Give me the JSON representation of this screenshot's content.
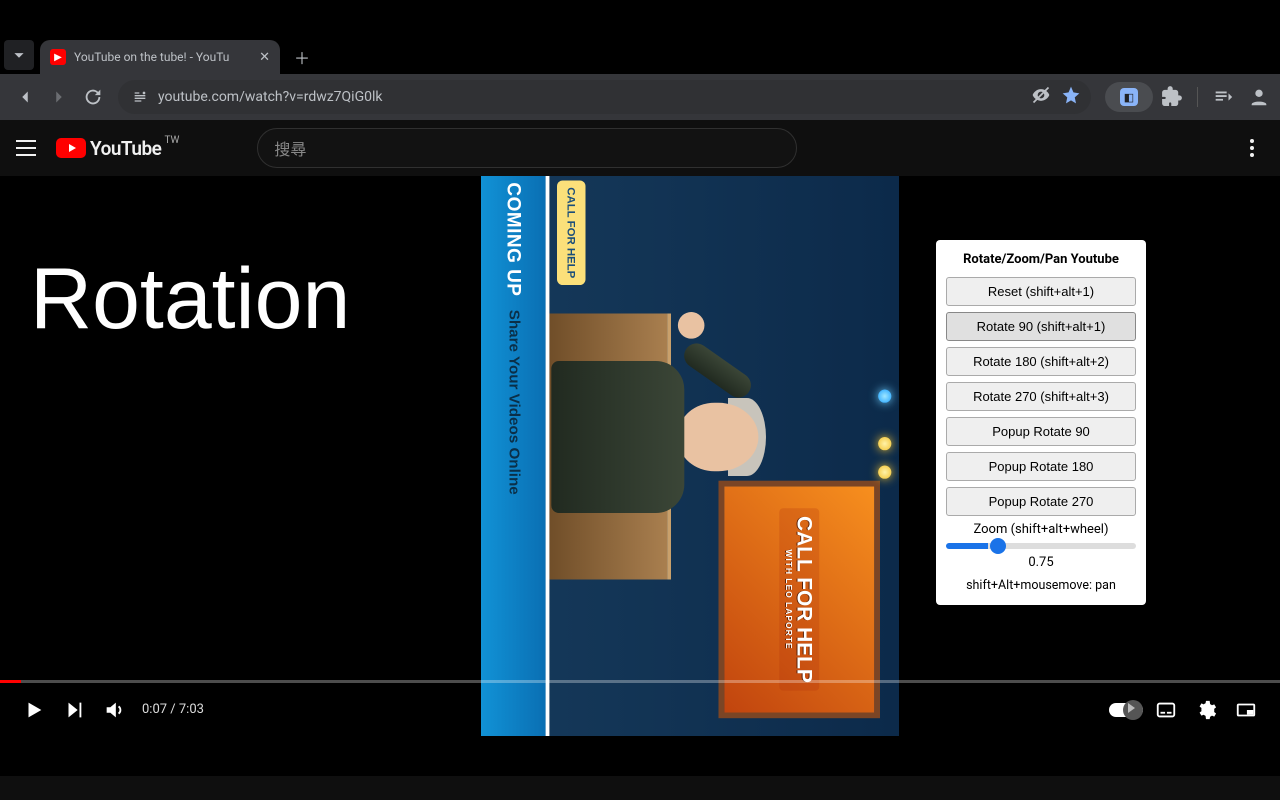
{
  "browser": {
    "tab_title": "YouTube on the tube! - YouTu",
    "url": "youtube.com/watch?v=rdwz7QiG0lk"
  },
  "youtube": {
    "logo_text": "YouTube",
    "region": "TW",
    "search_placeholder": "搜尋",
    "time": "0:07 / 7:03",
    "progress_percent": 1.66
  },
  "overlay": {
    "text": "Rotation"
  },
  "video_mock": {
    "coming_up": "COMING UP",
    "share_line": "Share Your Videos Online",
    "pill": "CALL FOR HELP",
    "screen_title": "CALL FOR HELP",
    "screen_sub": "WITH LEO LAPORTE"
  },
  "extension": {
    "title": "Rotate/Zoom/Pan Youtube",
    "buttons": [
      "Reset (shift+alt+1)",
      "Rotate 90 (shift+alt+1)",
      "Rotate 180 (shift+alt+2)",
      "Rotate 270 (shift+alt+3)",
      "Popup Rotate 90",
      "Popup Rotate 180",
      "Popup Rotate 270"
    ],
    "active_index": 1,
    "zoom_label": "Zoom (shift+alt+wheel)",
    "zoom_value": "0.75",
    "pan_hint": "shift+Alt+mousemove: pan"
  }
}
